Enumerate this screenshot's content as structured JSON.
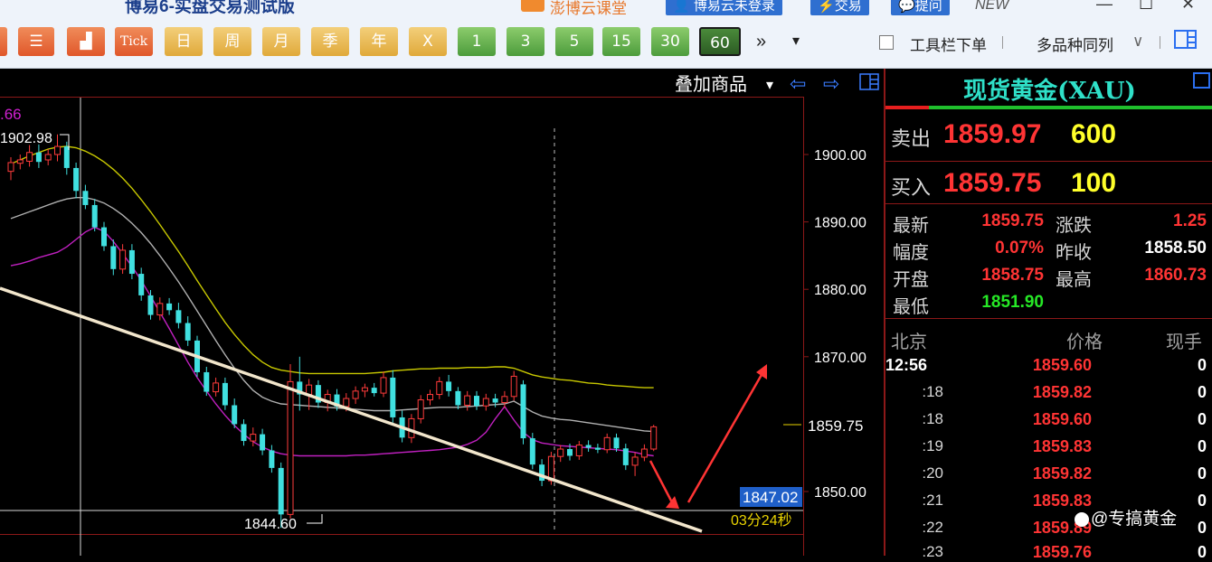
{
  "window": {
    "title": "博易6-实盘交易测试版",
    "promo": "澎博云课堂",
    "login_button": "博易云未登录",
    "trade_button": "交易",
    "help_button": "提问",
    "new_tag": "NEW",
    "minimize": "—",
    "maximize": "☐",
    "close": "✕"
  },
  "toolbar": {
    "buttons": [
      {
        "label": "",
        "icon": "list-icon",
        "style": "orange"
      },
      {
        "label": "",
        "icon": "bar-chart-icon",
        "style": "orange"
      },
      {
        "label": "Tick",
        "style": "orange"
      },
      {
        "label": "日",
        "style": "yellow"
      },
      {
        "label": "周",
        "style": "yellow"
      },
      {
        "label": "月",
        "style": "yellow"
      },
      {
        "label": "季",
        "style": "yellow"
      },
      {
        "label": "年",
        "style": "yellow"
      },
      {
        "label": "X",
        "style": "yellow"
      },
      {
        "label": "1",
        "style": "green"
      },
      {
        "label": "3",
        "style": "green"
      },
      {
        "label": "5",
        "style": "green"
      },
      {
        "label": "15",
        "style": "green"
      },
      {
        "label": "30",
        "style": "green"
      },
      {
        "label": "60",
        "style": "green",
        "active": true
      }
    ],
    "more_icon": "»",
    "dropdown_icon": "▾",
    "toolbar_below_label": "工具栏下单",
    "multi_label": "多品种同列",
    "multi_dropdown": "∨"
  },
  "chart": {
    "overlay_label": "叠加商品",
    "overlay_arrow": "▾",
    "nav_left": "⇦",
    "nav_right": "⇨",
    "indicator_fragment": ".66",
    "high_marker": "1902.98",
    "low_marker": "1844.60",
    "current_price_tag": "1859.75",
    "cursor_price_tag": "1847.02",
    "countdown": "03分24秒",
    "price_axis": [
      {
        "label": "1900.00",
        "value": 1900
      },
      {
        "label": "1890.00",
        "value": 1890
      },
      {
        "label": "1880.00",
        "value": 1880
      },
      {
        "label": "1870.00",
        "value": 1870
      },
      {
        "label": "1850.00",
        "value": 1850
      }
    ],
    "colors": {
      "up": "#ff3b3b",
      "down": "#40e0e0",
      "upper_band": "#c8c800",
      "mid_band": "#b0b0b0",
      "lower_band": "#c020c0",
      "trendline": "#f2e6cc",
      "arrow": "#ff3434"
    }
  },
  "chart_data": {
    "type": "candlestick",
    "series": [
      {
        "open": 1897.5,
        "high": 1899.6,
        "low": 1896.2,
        "close": 1898.8
      },
      {
        "open": 1898.7,
        "high": 1900.0,
        "low": 1897.8,
        "close": 1899.2
      },
      {
        "open": 1899.0,
        "high": 1901.4,
        "low": 1898.2,
        "close": 1900.3
      },
      {
        "open": 1900.3,
        "high": 1901.5,
        "low": 1898.0,
        "close": 1898.9
      },
      {
        "open": 1899.2,
        "high": 1900.8,
        "low": 1898.4,
        "close": 1900.0
      },
      {
        "open": 1900.0,
        "high": 1902.98,
        "low": 1899.0,
        "close": 1901.2
      },
      {
        "open": 1901.2,
        "high": 1901.9,
        "low": 1897.0,
        "close": 1898.0
      },
      {
        "open": 1898.0,
        "high": 1898.8,
        "low": 1893.5,
        "close": 1894.6
      },
      {
        "open": 1894.6,
        "high": 1895.5,
        "low": 1891.9,
        "close": 1892.5
      },
      {
        "open": 1892.5,
        "high": 1893.4,
        "low": 1888.6,
        "close": 1889.2
      },
      {
        "open": 1889.2,
        "high": 1890.0,
        "low": 1885.7,
        "close": 1886.4
      },
      {
        "open": 1886.4,
        "high": 1887.4,
        "low": 1882.1,
        "close": 1883.0
      },
      {
        "open": 1883.0,
        "high": 1886.7,
        "low": 1882.3,
        "close": 1885.8
      },
      {
        "open": 1885.8,
        "high": 1886.7,
        "low": 1881.5,
        "close": 1882.3
      },
      {
        "open": 1882.3,
        "high": 1883.2,
        "low": 1878.3,
        "close": 1879.1
      },
      {
        "open": 1879.1,
        "high": 1879.9,
        "low": 1875.5,
        "close": 1876.2
      },
      {
        "open": 1876.2,
        "high": 1878.8,
        "low": 1875.4,
        "close": 1877.9
      },
      {
        "open": 1877.9,
        "high": 1878.7,
        "low": 1876.2,
        "close": 1876.9
      },
      {
        "open": 1876.9,
        "high": 1878.0,
        "low": 1874.2,
        "close": 1875.0
      },
      {
        "open": 1875.0,
        "high": 1876.0,
        "low": 1871.6,
        "close": 1872.4
      },
      {
        "open": 1872.4,
        "high": 1873.1,
        "low": 1867.0,
        "close": 1867.7
      },
      {
        "open": 1867.7,
        "high": 1868.5,
        "low": 1864.2,
        "close": 1864.8
      },
      {
        "open": 1864.8,
        "high": 1866.9,
        "low": 1864.1,
        "close": 1866.1
      },
      {
        "open": 1866.1,
        "high": 1866.9,
        "low": 1862.1,
        "close": 1862.8
      },
      {
        "open": 1862.8,
        "high": 1863.8,
        "low": 1859.4,
        "close": 1860.0
      },
      {
        "open": 1860.0,
        "high": 1860.7,
        "low": 1856.8,
        "close": 1857.5
      },
      {
        "open": 1857.5,
        "high": 1859.5,
        "low": 1856.7,
        "close": 1858.5
      },
      {
        "open": 1858.5,
        "high": 1859.3,
        "low": 1855.4,
        "close": 1856.1
      },
      {
        "open": 1856.1,
        "high": 1856.9,
        "low": 1852.8,
        "close": 1853.5
      },
      {
        "open": 1853.5,
        "high": 1854.3,
        "low": 1844.6,
        "close": 1846.6
      },
      {
        "open": 1846.6,
        "high": 1868.9,
        "low": 1846.0,
        "close": 1866.3
      },
      {
        "open": 1866.3,
        "high": 1870.0,
        "low": 1862.0,
        "close": 1864.4
      },
      {
        "open": 1864.4,
        "high": 1866.7,
        "low": 1862.1,
        "close": 1865.8
      },
      {
        "open": 1865.8,
        "high": 1866.5,
        "low": 1862.4,
        "close": 1863.2
      },
      {
        "open": 1863.2,
        "high": 1865.1,
        "low": 1861.9,
        "close": 1864.4
      },
      {
        "open": 1864.4,
        "high": 1865.2,
        "low": 1862.0,
        "close": 1862.6
      },
      {
        "open": 1862.6,
        "high": 1864.6,
        "low": 1861.9,
        "close": 1863.8
      },
      {
        "open": 1863.8,
        "high": 1865.6,
        "low": 1863.0,
        "close": 1864.9
      },
      {
        "open": 1864.9,
        "high": 1866.0,
        "low": 1864.0,
        "close": 1865.4
      },
      {
        "open": 1865.4,
        "high": 1866.1,
        "low": 1864.1,
        "close": 1864.6
      },
      {
        "open": 1864.6,
        "high": 1867.8,
        "low": 1864.0,
        "close": 1866.9
      },
      {
        "open": 1866.9,
        "high": 1868.0,
        "low": 1860.2,
        "close": 1861.0
      },
      {
        "open": 1861.0,
        "high": 1862.0,
        "low": 1857.3,
        "close": 1858.0
      },
      {
        "open": 1858.0,
        "high": 1861.5,
        "low": 1857.2,
        "close": 1860.8
      },
      {
        "open": 1860.8,
        "high": 1864.3,
        "low": 1860.1,
        "close": 1863.6
      },
      {
        "open": 1863.6,
        "high": 1865.1,
        "low": 1862.8,
        "close": 1864.4
      },
      {
        "open": 1864.4,
        "high": 1867.0,
        "low": 1863.7,
        "close": 1866.3
      },
      {
        "open": 1866.3,
        "high": 1867.3,
        "low": 1864.1,
        "close": 1864.9
      },
      {
        "open": 1864.9,
        "high": 1865.5,
        "low": 1862.2,
        "close": 1862.8
      },
      {
        "open": 1862.8,
        "high": 1864.9,
        "low": 1862.0,
        "close": 1864.2
      },
      {
        "open": 1864.2,
        "high": 1864.9,
        "low": 1862.1,
        "close": 1862.7
      },
      {
        "open": 1862.7,
        "high": 1864.5,
        "low": 1862.0,
        "close": 1863.8
      },
      {
        "open": 1863.8,
        "high": 1864.5,
        "low": 1862.5,
        "close": 1863.2
      },
      {
        "open": 1863.2,
        "high": 1864.9,
        "low": 1862.4,
        "close": 1864.1
      },
      {
        "open": 1864.1,
        "high": 1867.9,
        "low": 1863.5,
        "close": 1867.1
      },
      {
        "open": 1865.9,
        "high": 1866.5,
        "low": 1857.0,
        "close": 1857.9
      },
      {
        "open": 1857.9,
        "high": 1858.7,
        "low": 1853.3,
        "close": 1854.0
      },
      {
        "open": 1854.0,
        "high": 1854.8,
        "low": 1850.8,
        "close": 1851.6
      },
      {
        "open": 1851.6,
        "high": 1855.9,
        "low": 1851.0,
        "close": 1855.2
      },
      {
        "open": 1855.2,
        "high": 1856.9,
        "low": 1854.4,
        "close": 1856.3
      },
      {
        "open": 1856.3,
        "high": 1857.1,
        "low": 1854.6,
        "close": 1855.3
      },
      {
        "open": 1855.3,
        "high": 1857.5,
        "low": 1854.7,
        "close": 1856.9
      },
      {
        "open": 1856.9,
        "high": 1857.6,
        "low": 1855.9,
        "close": 1856.5
      },
      {
        "open": 1856.5,
        "high": 1857.1,
        "low": 1855.7,
        "close": 1856.2
      },
      {
        "open": 1856.2,
        "high": 1858.6,
        "low": 1855.7,
        "close": 1858.0
      },
      {
        "open": 1858.0,
        "high": 1858.6,
        "low": 1855.9,
        "close": 1856.4
      },
      {
        "open": 1856.4,
        "high": 1857.1,
        "low": 1853.2,
        "close": 1853.9
      },
      {
        "open": 1853.9,
        "high": 1855.8,
        "low": 1852.3,
        "close": 1855.1
      },
      {
        "open": 1855.1,
        "high": 1857.0,
        "low": 1854.5,
        "close": 1856.3
      },
      {
        "open": 1856.3,
        "high": 1859.9,
        "low": 1856.0,
        "close": 1859.6
      }
    ],
    "bands": {
      "upper": [
        1898.6,
        1899.2,
        1899.8,
        1900.3,
        1900.8,
        1901.1,
        1901.2,
        1901.0,
        1900.5,
        1899.8,
        1898.9,
        1897.8,
        1896.5,
        1895.0,
        1893.3,
        1891.5,
        1889.6,
        1887.6,
        1885.6,
        1883.5,
        1881.3,
        1879.2,
        1877.1,
        1875.1,
        1873.3,
        1871.7,
        1870.3,
        1869.2,
        1868.4,
        1868.0,
        1867.8,
        1867.6,
        1867.5,
        1867.5,
        1867.5,
        1867.5,
        1867.5,
        1867.5,
        1867.5,
        1867.6,
        1867.7,
        1867.9,
        1868.0,
        1868.1,
        1868.2,
        1868.2,
        1868.3,
        1868.3,
        1868.3,
        1868.4,
        1868.4,
        1868.4,
        1868.5,
        1868.5,
        1868.3,
        1867.8,
        1867.3,
        1867.0,
        1866.8,
        1866.6,
        1866.5,
        1866.3,
        1866.1,
        1866.0,
        1865.8,
        1865.7,
        1865.6,
        1865.5,
        1865.4,
        1865.4
      ],
      "mid": [
        1890.5,
        1891.0,
        1891.5,
        1892.0,
        1892.5,
        1893.0,
        1893.4,
        1893.6,
        1893.6,
        1893.3,
        1892.8,
        1892.0,
        1891.0,
        1889.8,
        1888.4,
        1886.8,
        1885.0,
        1883.1,
        1881.1,
        1879.0,
        1876.8,
        1874.6,
        1872.4,
        1870.3,
        1868.3,
        1866.5,
        1865.0,
        1864.0,
        1863.4,
        1863.0,
        1862.9,
        1862.8,
        1862.7,
        1862.6,
        1862.5,
        1862.4,
        1862.3,
        1862.2,
        1862.1,
        1862.0,
        1862.0,
        1862.0,
        1862.1,
        1862.2,
        1862.3,
        1862.4,
        1862.5,
        1862.5,
        1862.5,
        1862.6,
        1862.7,
        1862.8,
        1862.9,
        1863.0,
        1863.4,
        1862.6,
        1861.8,
        1861.2,
        1860.9,
        1860.7,
        1860.6,
        1860.4,
        1860.2,
        1860.0,
        1859.8,
        1859.6,
        1859.4,
        1859.2,
        1859.0,
        1858.9
      ],
      "lower": [
        1883.5,
        1883.8,
        1884.2,
        1884.7,
        1885.1,
        1885.5,
        1886.3,
        1887.4,
        1888.5,
        1889.2,
        1888.6,
        1887.1,
        1885.3,
        1883.4,
        1881.3,
        1879.0,
        1876.6,
        1874.2,
        1871.7,
        1869.2,
        1866.9,
        1864.9,
        1863.0,
        1861.3,
        1859.8,
        1858.5,
        1857.4,
        1856.6,
        1856.0,
        1855.6,
        1855.4,
        1855.3,
        1855.3,
        1855.3,
        1855.3,
        1855.3,
        1855.3,
        1855.4,
        1855.4,
        1855.5,
        1855.6,
        1855.7,
        1855.8,
        1855.9,
        1856.0,
        1856.1,
        1856.2,
        1856.4,
        1856.6,
        1857.0,
        1857.6,
        1858.8,
        1860.8,
        1862.6,
        1860.6,
        1858.8,
        1857.7,
        1857.2,
        1857.0,
        1856.8,
        1856.7,
        1856.6,
        1856.5,
        1856.4,
        1856.3,
        1856.2,
        1856.0,
        1855.8,
        1855.5,
        1855.3
      ]
    },
    "axis_range": [
      1843,
      1907
    ]
  },
  "quote": {
    "symbol": "现货黄金(XAU)",
    "sell_label": "卖出",
    "sell_price": "1859.97",
    "sell_volume": "600",
    "buy_label": "买入",
    "buy_price": "1859.75",
    "buy_volume": "100",
    "stats": [
      {
        "label": "最新",
        "value": "1859.75",
        "color": "#ff3434"
      },
      {
        "label": "涨跌",
        "value": "1.25",
        "color": "#ff3434"
      },
      {
        "label": "幅度",
        "value": "0.07%",
        "color": "#ff3434"
      },
      {
        "label": "昨收",
        "value": "1858.50",
        "color": "#ffffff"
      },
      {
        "label": "开盘",
        "value": "1858.75",
        "color": "#ff3434"
      },
      {
        "label": "最高",
        "value": "1860.73",
        "color": "#ff3434"
      },
      {
        "label": "最低",
        "value": "1851.90",
        "color": "#26e826"
      }
    ],
    "tick_header": {
      "time": "北京",
      "price": "价格",
      "volume": "现手"
    },
    "ticks": [
      {
        "time": "12:56",
        "price": "1859.60",
        "volume": "0"
      },
      {
        "time": ":18",
        "price": "1859.82",
        "volume": "0"
      },
      {
        "time": ":18",
        "price": "1859.60",
        "volume": "0"
      },
      {
        "time": ":19",
        "price": "1859.83",
        "volume": "0"
      },
      {
        "time": ":20",
        "price": "1859.82",
        "volume": "0"
      },
      {
        "time": ":21",
        "price": "1859.83",
        "volume": "0"
      },
      {
        "time": ":22",
        "price": "1859.89",
        "volume": "0"
      },
      {
        "time": ":23",
        "price": "1859.76",
        "volume": "0"
      }
    ]
  },
  "watermark": "@专搞黄金"
}
